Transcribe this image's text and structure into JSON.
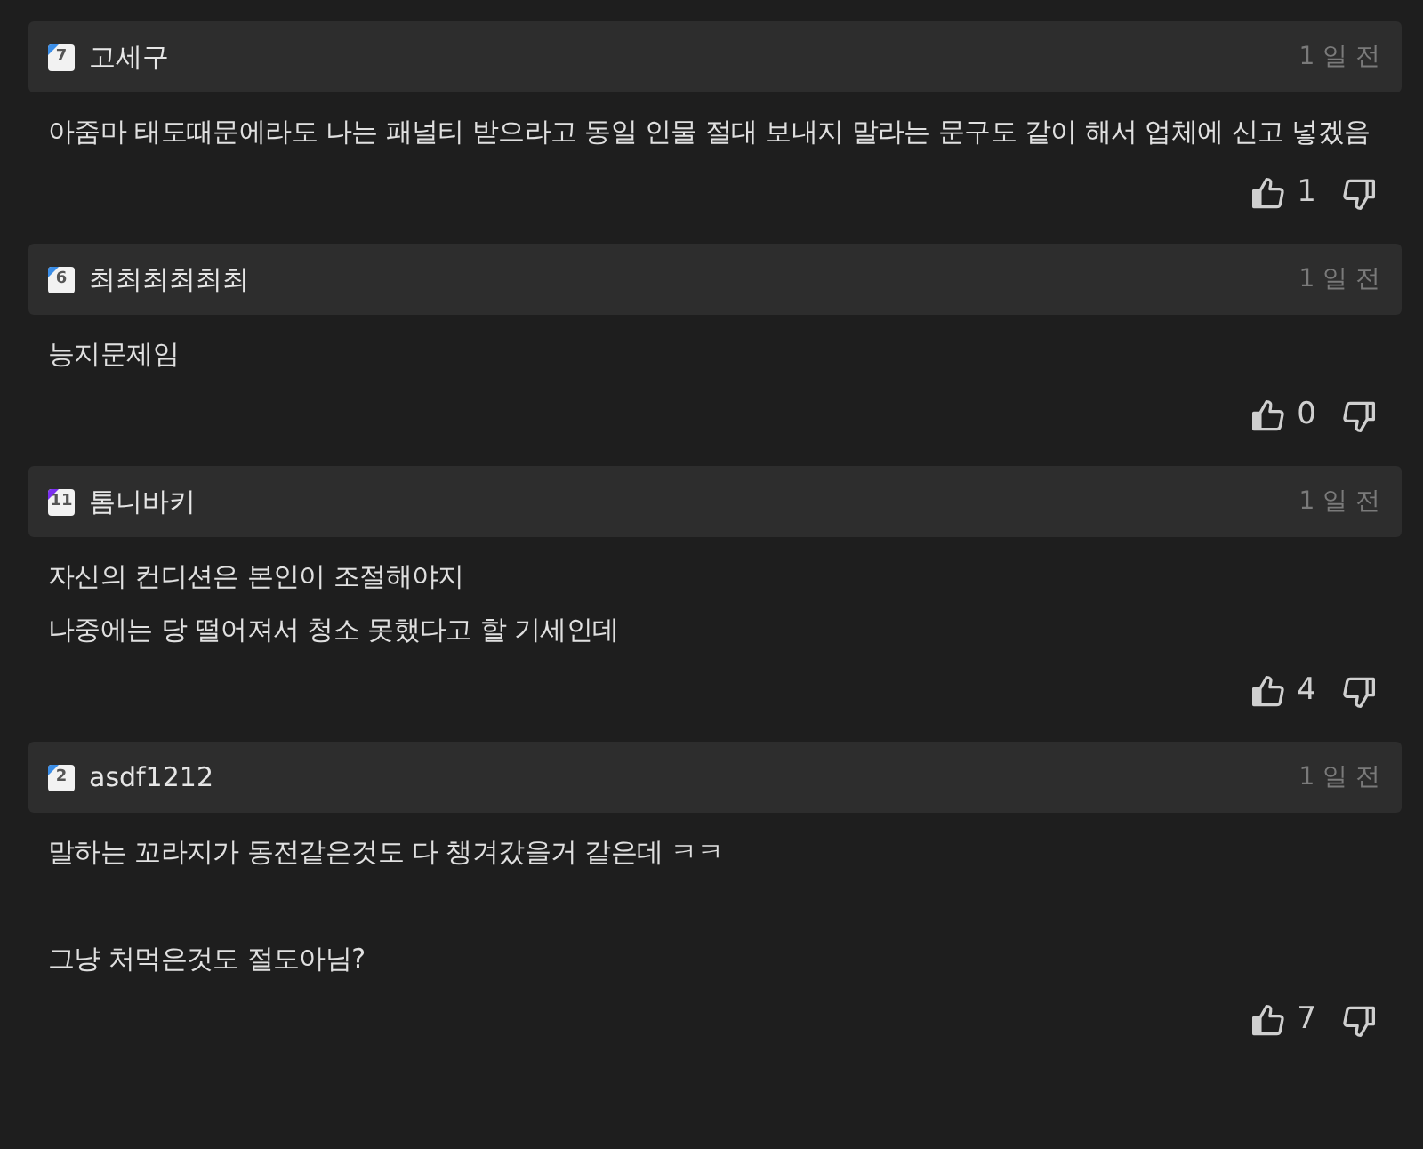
{
  "comments": [
    {
      "badge": "7",
      "color": "#3b8ee8",
      "author": "고세구",
      "time": "1 일 전",
      "paragraphs": [
        [
          "아줌마 태도때문에라도 나는 패널티 받으라고 동일 인물 절대 보내지 말라는 문구도 같이 해서 업체에 신고 넣겠음"
        ]
      ],
      "likes": "1"
    },
    {
      "badge": "6",
      "color": "#3b8ee8",
      "author": "최최최최최최",
      "time": "1 일 전",
      "paragraphs": [
        [
          "능지문제임"
        ]
      ],
      "likes": "0"
    },
    {
      "badge": "11",
      "color": "#7b2ff0",
      "author": "톰니바키",
      "time": "1 일 전",
      "paragraphs": [
        [
          "자신의 컨디션은 본인이 조절해야지",
          "나중에는 당 떨어져서 청소 못했다고 할 기세인데"
        ]
      ],
      "likes": "4"
    },
    {
      "badge": "2",
      "color": "#3b8ee8",
      "author": "asdf1212",
      "time": "1 일 전",
      "paragraphs": [
        [
          "말하는 꼬라지가 동전같은것도 다 챙겨갔을거 같은데 ㅋㅋ"
        ],
        [
          "그냥 처먹은것도 절도아님?"
        ]
      ],
      "likes": "7"
    }
  ]
}
